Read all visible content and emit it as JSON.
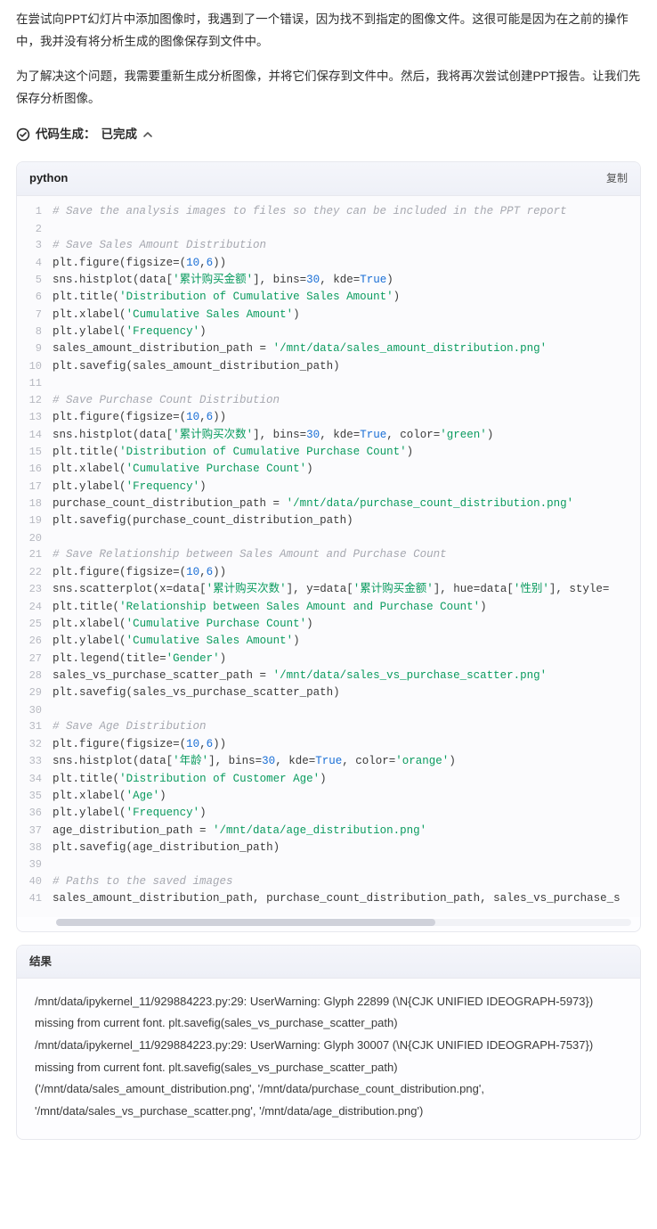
{
  "message": {
    "para1": "在尝试向PPT幻灯片中添加图像时，我遇到了一个错误，因为找不到指定的图像文件。这很可能是因为在之前的操作中，我并没有将分析生成的图像保存到文件中。",
    "para2": "为了解决这个问题，我需要重新生成分析图像，并将它们保存到文件中。然后，我将再次尝试创建PPT报告。让我们先保存分析图像。"
  },
  "status": {
    "label": "代码生成：",
    "state": "已完成"
  },
  "code": {
    "language": "python",
    "copy_label": "复制",
    "lines": [
      {
        "n": 1,
        "t": "comment",
        "text": "# Save the analysis images to files so they can be included in the PPT report"
      },
      {
        "n": 2,
        "t": "blank",
        "text": ""
      },
      {
        "n": 3,
        "t": "comment",
        "text": "# Save Sales Amount Distribution"
      },
      {
        "n": 4,
        "t": "code",
        "tokens": [
          "plt",
          ".",
          "figure",
          "(",
          "figsize",
          "=",
          "(",
          "10",
          ",",
          "6",
          ")",
          ")"
        ],
        "cls": [
          "pa",
          "op",
          "fn",
          "op",
          "pa",
          "op",
          "op",
          "nm",
          "op",
          "nm",
          "op",
          "op"
        ]
      },
      {
        "n": 5,
        "t": "code",
        "tokens": [
          "sns",
          ".",
          "histplot",
          "(",
          "data",
          "[",
          "'累计购买金额'",
          "]",
          ", ",
          "bins",
          "=",
          "30",
          ", ",
          "kde",
          "=",
          "True",
          ")"
        ],
        "cls": [
          "pa",
          "op",
          "fn",
          "op",
          "pa",
          "op",
          "s",
          "op",
          "op",
          "pa",
          "op",
          "nm",
          "op",
          "pa",
          "op",
          "kc",
          "op"
        ]
      },
      {
        "n": 6,
        "t": "code",
        "tokens": [
          "plt",
          ".",
          "title",
          "(",
          "'Distribution of Cumulative Sales Amount'",
          ")"
        ],
        "cls": [
          "pa",
          "op",
          "fn",
          "op",
          "s",
          "op"
        ]
      },
      {
        "n": 7,
        "t": "code",
        "tokens": [
          "plt",
          ".",
          "xlabel",
          "(",
          "'Cumulative Sales Amount'",
          ")"
        ],
        "cls": [
          "pa",
          "op",
          "fn",
          "op",
          "s",
          "op"
        ]
      },
      {
        "n": 8,
        "t": "code",
        "tokens": [
          "plt",
          ".",
          "ylabel",
          "(",
          "'Frequency'",
          ")"
        ],
        "cls": [
          "pa",
          "op",
          "fn",
          "op",
          "s",
          "op"
        ]
      },
      {
        "n": 9,
        "t": "code",
        "tokens": [
          "sales_amount_distribution_path",
          " = ",
          "'/mnt/data/sales_amount_distribution.png'"
        ],
        "cls": [
          "pa",
          "op",
          "s"
        ]
      },
      {
        "n": 10,
        "t": "code",
        "tokens": [
          "plt",
          ".",
          "savefig",
          "(",
          "sales_amount_distribution_path",
          ")"
        ],
        "cls": [
          "pa",
          "op",
          "fn",
          "op",
          "pa",
          "op"
        ]
      },
      {
        "n": 11,
        "t": "blank",
        "text": ""
      },
      {
        "n": 12,
        "t": "comment",
        "text": "# Save Purchase Count Distribution"
      },
      {
        "n": 13,
        "t": "code",
        "tokens": [
          "plt",
          ".",
          "figure",
          "(",
          "figsize",
          "=",
          "(",
          "10",
          ",",
          "6",
          ")",
          ")"
        ],
        "cls": [
          "pa",
          "op",
          "fn",
          "op",
          "pa",
          "op",
          "op",
          "nm",
          "op",
          "nm",
          "op",
          "op"
        ]
      },
      {
        "n": 14,
        "t": "code",
        "tokens": [
          "sns",
          ".",
          "histplot",
          "(",
          "data",
          "[",
          "'累计购买次数'",
          "]",
          ", ",
          "bins",
          "=",
          "30",
          ", ",
          "kde",
          "=",
          "True",
          ", ",
          "color",
          "=",
          "'green'",
          ")"
        ],
        "cls": [
          "pa",
          "op",
          "fn",
          "op",
          "pa",
          "op",
          "s",
          "op",
          "op",
          "pa",
          "op",
          "nm",
          "op",
          "pa",
          "op",
          "kc",
          "op",
          "pa",
          "op",
          "s",
          "op"
        ]
      },
      {
        "n": 15,
        "t": "code",
        "tokens": [
          "plt",
          ".",
          "title",
          "(",
          "'Distribution of Cumulative Purchase Count'",
          ")"
        ],
        "cls": [
          "pa",
          "op",
          "fn",
          "op",
          "s",
          "op"
        ]
      },
      {
        "n": 16,
        "t": "code",
        "tokens": [
          "plt",
          ".",
          "xlabel",
          "(",
          "'Cumulative Purchase Count'",
          ")"
        ],
        "cls": [
          "pa",
          "op",
          "fn",
          "op",
          "s",
          "op"
        ]
      },
      {
        "n": 17,
        "t": "code",
        "tokens": [
          "plt",
          ".",
          "ylabel",
          "(",
          "'Frequency'",
          ")"
        ],
        "cls": [
          "pa",
          "op",
          "fn",
          "op",
          "s",
          "op"
        ]
      },
      {
        "n": 18,
        "t": "code",
        "tokens": [
          "purchase_count_distribution_path",
          " = ",
          "'/mnt/data/purchase_count_distribution.png'"
        ],
        "cls": [
          "pa",
          "op",
          "s"
        ]
      },
      {
        "n": 19,
        "t": "code",
        "tokens": [
          "plt",
          ".",
          "savefig",
          "(",
          "purchase_count_distribution_path",
          ")"
        ],
        "cls": [
          "pa",
          "op",
          "fn",
          "op",
          "pa",
          "op"
        ]
      },
      {
        "n": 20,
        "t": "blank",
        "text": ""
      },
      {
        "n": 21,
        "t": "comment",
        "text": "# Save Relationship between Sales Amount and Purchase Count"
      },
      {
        "n": 22,
        "t": "code",
        "tokens": [
          "plt",
          ".",
          "figure",
          "(",
          "figsize",
          "=",
          "(",
          "10",
          ",",
          "6",
          ")",
          ")"
        ],
        "cls": [
          "pa",
          "op",
          "fn",
          "op",
          "pa",
          "op",
          "op",
          "nm",
          "op",
          "nm",
          "op",
          "op"
        ]
      },
      {
        "n": 23,
        "t": "code",
        "tokens": [
          "sns",
          ".",
          "scatterplot",
          "(",
          "x",
          "=",
          "data",
          "[",
          "'累计购买次数'",
          "]",
          ", ",
          "y",
          "=",
          "data",
          "[",
          "'累计购买金额'",
          "]",
          ", ",
          "hue",
          "=",
          "data",
          "[",
          "'性别'",
          "]",
          ", ",
          "style",
          "="
        ],
        "cls": [
          "pa",
          "op",
          "fn",
          "op",
          "pa",
          "op",
          "pa",
          "op",
          "s",
          "op",
          "op",
          "pa",
          "op",
          "pa",
          "op",
          "s",
          "op",
          "op",
          "pa",
          "op",
          "pa",
          "op",
          "s",
          "op",
          "op",
          "pa",
          "op"
        ]
      },
      {
        "n": 24,
        "t": "code",
        "tokens": [
          "plt",
          ".",
          "title",
          "(",
          "'Relationship between Sales Amount and Purchase Count'",
          ")"
        ],
        "cls": [
          "pa",
          "op",
          "fn",
          "op",
          "s",
          "op"
        ]
      },
      {
        "n": 25,
        "t": "code",
        "tokens": [
          "plt",
          ".",
          "xlabel",
          "(",
          "'Cumulative Purchase Count'",
          ")"
        ],
        "cls": [
          "pa",
          "op",
          "fn",
          "op",
          "s",
          "op"
        ]
      },
      {
        "n": 26,
        "t": "code",
        "tokens": [
          "plt",
          ".",
          "ylabel",
          "(",
          "'Cumulative Sales Amount'",
          ")"
        ],
        "cls": [
          "pa",
          "op",
          "fn",
          "op",
          "s",
          "op"
        ]
      },
      {
        "n": 27,
        "t": "code",
        "tokens": [
          "plt",
          ".",
          "legend",
          "(",
          "title",
          "=",
          "'Gender'",
          ")"
        ],
        "cls": [
          "pa",
          "op",
          "fn",
          "op",
          "pa",
          "op",
          "s",
          "op"
        ]
      },
      {
        "n": 28,
        "t": "code",
        "tokens": [
          "sales_vs_purchase_scatter_path",
          " = ",
          "'/mnt/data/sales_vs_purchase_scatter.png'"
        ],
        "cls": [
          "pa",
          "op",
          "s"
        ]
      },
      {
        "n": 29,
        "t": "code",
        "tokens": [
          "plt",
          ".",
          "savefig",
          "(",
          "sales_vs_purchase_scatter_path",
          ")"
        ],
        "cls": [
          "pa",
          "op",
          "fn",
          "op",
          "pa",
          "op"
        ]
      },
      {
        "n": 30,
        "t": "blank",
        "text": ""
      },
      {
        "n": 31,
        "t": "comment",
        "text": "# Save Age Distribution"
      },
      {
        "n": 32,
        "t": "code",
        "tokens": [
          "plt",
          ".",
          "figure",
          "(",
          "figsize",
          "=",
          "(",
          "10",
          ",",
          "6",
          ")",
          ")"
        ],
        "cls": [
          "pa",
          "op",
          "fn",
          "op",
          "pa",
          "op",
          "op",
          "nm",
          "op",
          "nm",
          "op",
          "op"
        ]
      },
      {
        "n": 33,
        "t": "code",
        "tokens": [
          "sns",
          ".",
          "histplot",
          "(",
          "data",
          "[",
          "'年龄'",
          "]",
          ", ",
          "bins",
          "=",
          "30",
          ", ",
          "kde",
          "=",
          "True",
          ", ",
          "color",
          "=",
          "'orange'",
          ")"
        ],
        "cls": [
          "pa",
          "op",
          "fn",
          "op",
          "pa",
          "op",
          "s",
          "op",
          "op",
          "pa",
          "op",
          "nm",
          "op",
          "pa",
          "op",
          "kc",
          "op",
          "pa",
          "op",
          "s",
          "op"
        ]
      },
      {
        "n": 34,
        "t": "code",
        "tokens": [
          "plt",
          ".",
          "title",
          "(",
          "'Distribution of Customer Age'",
          ")"
        ],
        "cls": [
          "pa",
          "op",
          "fn",
          "op",
          "s",
          "op"
        ]
      },
      {
        "n": 35,
        "t": "code",
        "tokens": [
          "plt",
          ".",
          "xlabel",
          "(",
          "'Age'",
          ")"
        ],
        "cls": [
          "pa",
          "op",
          "fn",
          "op",
          "s",
          "op"
        ]
      },
      {
        "n": 36,
        "t": "code",
        "tokens": [
          "plt",
          ".",
          "ylabel",
          "(",
          "'Frequency'",
          ")"
        ],
        "cls": [
          "pa",
          "op",
          "fn",
          "op",
          "s",
          "op"
        ]
      },
      {
        "n": 37,
        "t": "code",
        "tokens": [
          "age_distribution_path",
          " = ",
          "'/mnt/data/age_distribution.png'"
        ],
        "cls": [
          "pa",
          "op",
          "s"
        ]
      },
      {
        "n": 38,
        "t": "code",
        "tokens": [
          "plt",
          ".",
          "savefig",
          "(",
          "age_distribution_path",
          ")"
        ],
        "cls": [
          "pa",
          "op",
          "fn",
          "op",
          "pa",
          "op"
        ]
      },
      {
        "n": 39,
        "t": "blank",
        "text": ""
      },
      {
        "n": 40,
        "t": "comment",
        "text": "# Paths to the saved images"
      },
      {
        "n": 41,
        "t": "code",
        "tokens": [
          "sales_amount_distribution_path",
          ", ",
          "purchase_count_distribution_path",
          ", ",
          "sales_vs_purchase_s"
        ],
        "cls": [
          "pa",
          "op",
          "pa",
          "op",
          "pa"
        ]
      }
    ]
  },
  "result": {
    "label": "结果",
    "lines": [
      "/mnt/data/ipykernel_11/929884223.py:29: UserWarning: Glyph 22899 (\\N{CJK UNIFIED IDEOGRAPH-5973}) missing from current font. plt.savefig(sales_vs_purchase_scatter_path)",
      "/mnt/data/ipykernel_11/929884223.py:29: UserWarning: Glyph 30007 (\\N{CJK UNIFIED IDEOGRAPH-7537}) missing from current font. plt.savefig(sales_vs_purchase_scatter_path)",
      "('/mnt/data/sales_amount_distribution.png', '/mnt/data/purchase_count_distribution.png', '/mnt/data/sales_vs_purchase_scatter.png', '/mnt/data/age_distribution.png')"
    ]
  }
}
